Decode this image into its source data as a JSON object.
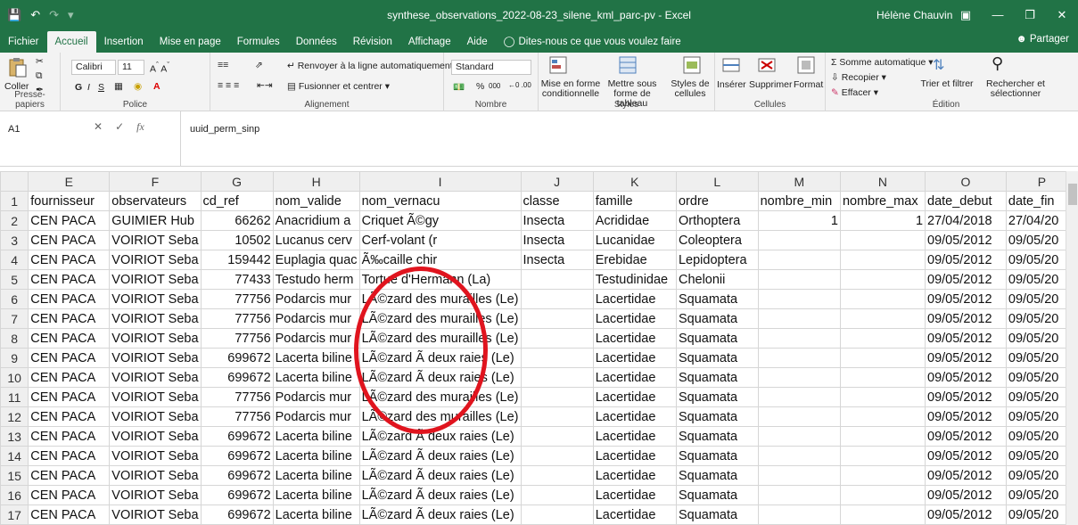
{
  "window": {
    "title": "synthese_observations_2022-08-23_silene_kml_parc-pv  -  Excel",
    "user": "Hélène Chauvin",
    "share_label": "Partager"
  },
  "tabs": [
    "Fichier",
    "Accueil",
    "Insertion",
    "Mise en page",
    "Formules",
    "Données",
    "Révision",
    "Affichage",
    "Aide"
  ],
  "tellme": "Dites-nous ce que vous voulez faire",
  "ribbon": {
    "clipboard": {
      "paste": "Coller",
      "label": "Presse-papiers"
    },
    "font": {
      "name": "Calibri",
      "size": "11",
      "label": "Police"
    },
    "alignment": {
      "wrap": "Renvoyer à la ligne automatiquement",
      "merge": "Fusionner et centrer",
      "label": "Alignement"
    },
    "number": {
      "format": "Standard",
      "percent": "%",
      "thousands": "000",
      "label": "Nombre"
    },
    "styles": {
      "conditional": "Mise en forme conditionnelle",
      "table": "Mettre sous forme de tableau",
      "cell": "Styles de cellules",
      "label": "Styles"
    },
    "cells": {
      "insert": "Insérer",
      "delete": "Supprimer",
      "format": "Format",
      "label": "Cellules"
    },
    "editing": {
      "autosum": "Somme automatique",
      "fill": "Recopier",
      "clear": "Effacer",
      "sort": "Trier et filtrer",
      "find": "Rechercher et sélectionner",
      "label": "Édition"
    }
  },
  "formula_bar": {
    "namebox": "A1",
    "fx": "fx",
    "content": "uuid_perm_sinp"
  },
  "columns": [
    "E",
    "F",
    "G",
    "H",
    "I",
    "J",
    "K",
    "L",
    "M",
    "N",
    "O",
    "P"
  ],
  "rows": [
    {
      "n": "1",
      "c": [
        "fournisseur",
        "observateurs",
        "cd_ref",
        "nom_valide",
        "nom_vernacu",
        "classe",
        "famille",
        "ordre",
        "nombre_min",
        "nombre_max",
        "date_debut",
        "date_fin"
      ]
    },
    {
      "n": "2",
      "c": [
        "CEN PACA",
        "GUIMIER Hub",
        "66262",
        "Anacridium a",
        "Criquet Ã©gy",
        "Insecta",
        "Acrididae",
        "Orthoptera",
        "1",
        "1",
        "27/04/2018",
        "27/04/20"
      ]
    },
    {
      "n": "3",
      "c": [
        "CEN PACA",
        "VOIRIOT Seba",
        "10502",
        "Lucanus cerv",
        "Cerf-volant (r",
        "Insecta",
        "Lucanidae",
        "Coleoptera",
        "",
        "",
        "09/05/2012",
        "09/05/20"
      ]
    },
    {
      "n": "4",
      "c": [
        "CEN PACA",
        "VOIRIOT Seba",
        "159442",
        "Euplagia quac",
        "Ã‰caille chir",
        "Insecta",
        "Erebidae",
        "Lepidoptera",
        "",
        "",
        "09/05/2012",
        "09/05/20"
      ]
    },
    {
      "n": "5",
      "c": [
        "CEN PACA",
        "VOIRIOT Seba",
        "77433",
        "Testudo herm",
        "Tortue d'Hermann (La)",
        "",
        "Testudinidae",
        "Chelonii",
        "",
        "",
        "09/05/2012",
        "09/05/20"
      ]
    },
    {
      "n": "6",
      "c": [
        "CEN PACA",
        "VOIRIOT Seba",
        "77756",
        "Podarcis mur",
        "LÃ©zard des murailles (Le)",
        "",
        "Lacertidae",
        "Squamata",
        "",
        "",
        "09/05/2012",
        "09/05/20"
      ]
    },
    {
      "n": "7",
      "c": [
        "CEN PACA",
        "VOIRIOT Seba",
        "77756",
        "Podarcis mur",
        "LÃ©zard des murailles (Le)",
        "",
        "Lacertidae",
        "Squamata",
        "",
        "",
        "09/05/2012",
        "09/05/20"
      ]
    },
    {
      "n": "8",
      "c": [
        "CEN PACA",
        "VOIRIOT Seba",
        "77756",
        "Podarcis mur",
        "LÃ©zard des murailles (Le)",
        "",
        "Lacertidae",
        "Squamata",
        "",
        "",
        "09/05/2012",
        "09/05/20"
      ]
    },
    {
      "n": "9",
      "c": [
        "CEN PACA",
        "VOIRIOT Seba",
        "699672",
        "Lacerta biline",
        "LÃ©zard Ã  deux raies (Le)",
        "",
        "Lacertidae",
        "Squamata",
        "",
        "",
        "09/05/2012",
        "09/05/20"
      ]
    },
    {
      "n": "10",
      "c": [
        "CEN PACA",
        "VOIRIOT Seba",
        "699672",
        "Lacerta biline",
        "LÃ©zard Ã  deux raies (Le)",
        "",
        "Lacertidae",
        "Squamata",
        "",
        "",
        "09/05/2012",
        "09/05/20"
      ]
    },
    {
      "n": "11",
      "c": [
        "CEN PACA",
        "VOIRIOT Seba",
        "77756",
        "Podarcis mur",
        "LÃ©zard des murailles (Le)",
        "",
        "Lacertidae",
        "Squamata",
        "",
        "",
        "09/05/2012",
        "09/05/20"
      ]
    },
    {
      "n": "12",
      "c": [
        "CEN PACA",
        "VOIRIOT Seba",
        "77756",
        "Podarcis mur",
        "LÃ©zard des murailles (Le)",
        "",
        "Lacertidae",
        "Squamata",
        "",
        "",
        "09/05/2012",
        "09/05/20"
      ]
    },
    {
      "n": "13",
      "c": [
        "CEN PACA",
        "VOIRIOT Seba",
        "699672",
        "Lacerta biline",
        "LÃ©zard Ã  deux raies (Le)",
        "",
        "Lacertidae",
        "Squamata",
        "",
        "",
        "09/05/2012",
        "09/05/20"
      ]
    },
    {
      "n": "14",
      "c": [
        "CEN PACA",
        "VOIRIOT Seba",
        "699672",
        "Lacerta biline",
        "LÃ©zard Ã  deux raies (Le)",
        "",
        "Lacertidae",
        "Squamata",
        "",
        "",
        "09/05/2012",
        "09/05/20"
      ]
    },
    {
      "n": "15",
      "c": [
        "CEN PACA",
        "VOIRIOT Seba",
        "699672",
        "Lacerta biline",
        "LÃ©zard Ã  deux raies (Le)",
        "",
        "Lacertidae",
        "Squamata",
        "",
        "",
        "09/05/2012",
        "09/05/20"
      ]
    },
    {
      "n": "16",
      "c": [
        "CEN PACA",
        "VOIRIOT Seba",
        "699672",
        "Lacerta biline",
        "LÃ©zard Ã  deux raies (Le)",
        "",
        "Lacertidae",
        "Squamata",
        "",
        "",
        "09/05/2012",
        "09/05/20"
      ]
    },
    {
      "n": "17",
      "c": [
        "CEN PACA",
        "VOIRIOT Seba",
        "699672",
        "Lacerta biline",
        "LÃ©zard Ã  deux raies (Le)",
        "",
        "Lacertidae",
        "Squamata",
        "",
        "",
        "09/05/2012",
        "09/05/20"
      ]
    }
  ],
  "colors": {
    "excel_green": "#217346",
    "annotation_red": "#e0141e"
  }
}
